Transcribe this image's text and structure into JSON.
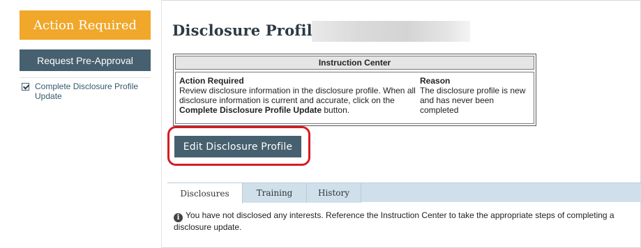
{
  "sidebar": {
    "action_required": "Action Required",
    "request_preapproval": "Request Pre-Approval",
    "items": [
      {
        "label": "Complete Disclosure Profile Update",
        "icon": "checkbox-checked-icon"
      }
    ]
  },
  "main": {
    "title": "Disclosure Profile for",
    "instruction_center": {
      "header": "Instruction Center",
      "action_heading": "Action Required",
      "action_text_1": "Review disclosure information in the disclosure profile. When all disclosure information is current and accurate, click on the ",
      "action_text_bold": "Complete Disclosure Profile Update",
      "action_text_2": " button.",
      "reason_heading": "Reason",
      "reason_text": "The disclosure profile is new and has never been completed"
    },
    "edit_button": "Edit Disclosure Profile",
    "tabs": [
      {
        "label": "Disclosures",
        "active": true
      },
      {
        "label": "Training",
        "active": false
      },
      {
        "label": "History",
        "active": false
      }
    ],
    "notice": {
      "icon": "info-icon",
      "icon_glyph": "i",
      "text": "You have not disclosed any interests. Reference the Instruction Center to take the appropriate steps of completing a disclosure update."
    }
  },
  "colors": {
    "action_orange": "#f0a72a",
    "button_slate": "#46606f",
    "highlight_red": "#d41d25",
    "tab_bar_blue": "#cfe0eb"
  }
}
